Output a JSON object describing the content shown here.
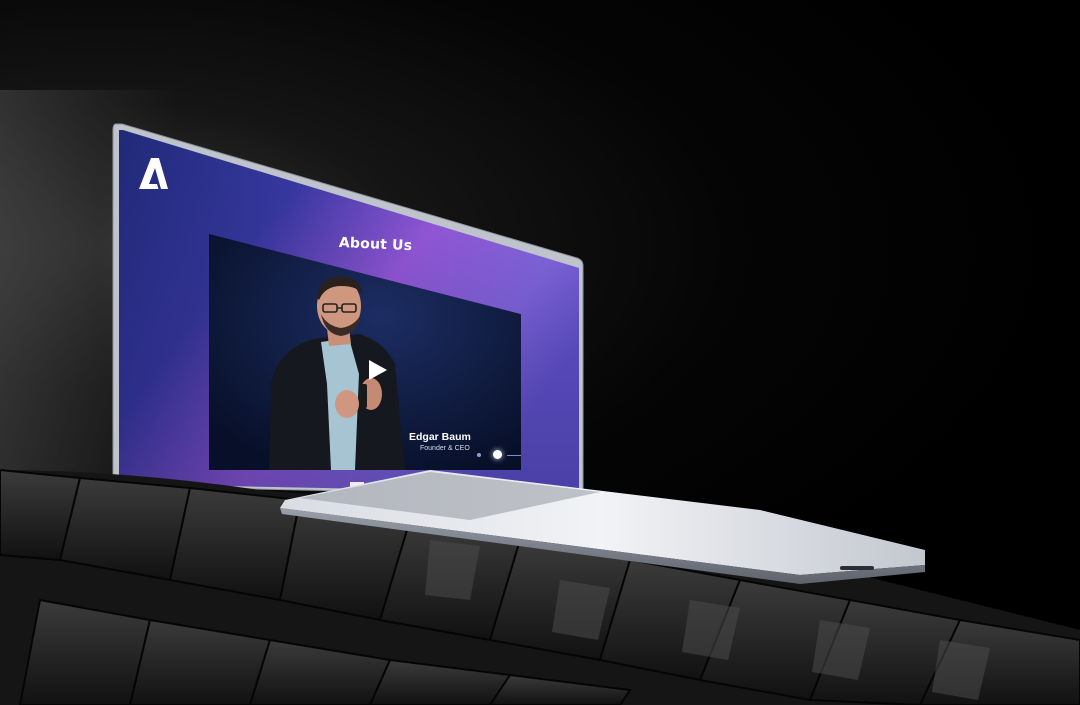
{
  "page": {
    "section_title": "About Us"
  },
  "logo": {
    "icon": "letter-a-logo-icon"
  },
  "video": {
    "person_name": "Edgar Baum",
    "person_role": "Founder & CEO",
    "play_icon": "play-icon",
    "slides_total": 3,
    "active_slide": 2
  },
  "colors": {
    "screen_gradient_start": "#2a2a8a",
    "screen_gradient_mid": "#7b4fd8",
    "screen_gradient_end": "#b07cf0",
    "accent": "#a66ef0",
    "background": "#000000"
  }
}
